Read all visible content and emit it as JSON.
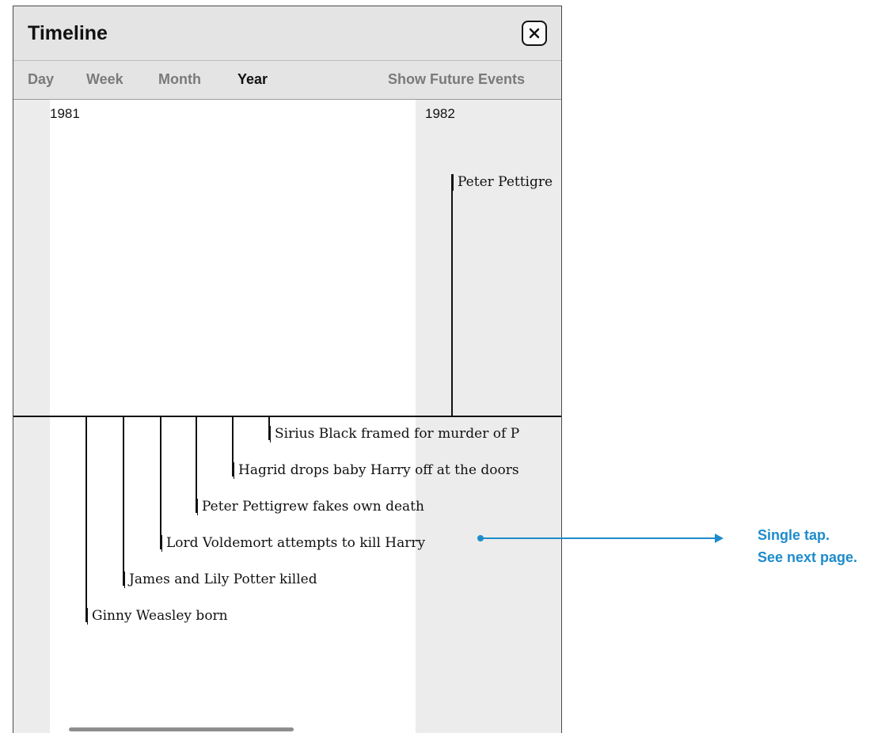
{
  "header": {
    "title": "Timeline",
    "close_icon": "close-icon"
  },
  "tabs": [
    {
      "label": "Day",
      "active": false
    },
    {
      "label": "Week",
      "active": false
    },
    {
      "label": "Month",
      "active": false
    },
    {
      "label": "Year",
      "active": true
    }
  ],
  "show_future_label": "Show Future Events",
  "years": [
    "1981",
    "1982"
  ],
  "events_above": [
    {
      "label": "Peter Pettigre"
    }
  ],
  "events_below": [
    {
      "label": "Sirius Black framed for murder of P"
    },
    {
      "label": "Hagrid drops baby Harry off at the doors"
    },
    {
      "label": "Peter Pettigrew fakes own death"
    },
    {
      "label": "Lord Voldemort attempts to kill Harry"
    },
    {
      "label": "James and Lily Potter killed"
    },
    {
      "label": "Ginny Weasley born"
    }
  ],
  "callout": {
    "line1": "Single tap.",
    "line2": "See next page.",
    "color": "#1d8ccc"
  },
  "colors": {
    "header_bg": "#e4e4e4",
    "band_bg": "#ececec",
    "accent": "#1d8ccc"
  }
}
